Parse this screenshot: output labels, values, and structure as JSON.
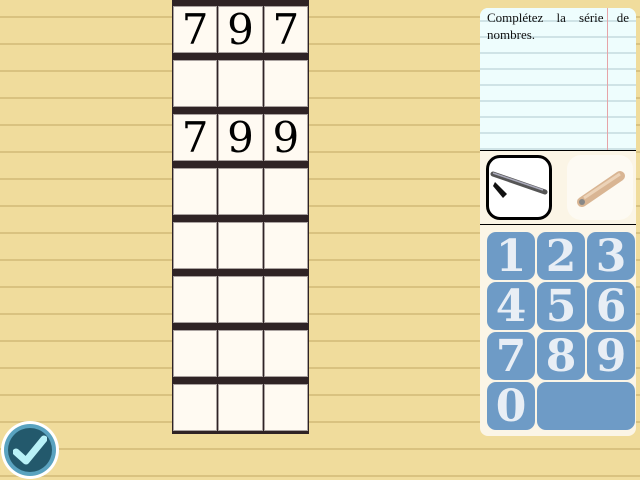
{
  "grid": {
    "rows": [
      [
        "7",
        "9",
        "7"
      ],
      [
        "",
        "",
        ""
      ],
      [
        "7",
        "9",
        "9"
      ],
      [
        "",
        "",
        ""
      ],
      [
        "",
        "",
        ""
      ],
      [
        "",
        "",
        ""
      ],
      [
        "",
        "",
        ""
      ],
      [
        "",
        "",
        ""
      ]
    ]
  },
  "instruction": "Complétez la série de nombres.",
  "tools": [
    {
      "name": "pen-icon",
      "selected": true
    },
    {
      "name": "pencil-icon",
      "selected": false
    }
  ],
  "keypad": [
    "1",
    "2",
    "3",
    "4",
    "5",
    "6",
    "7",
    "8",
    "9",
    "0",
    ""
  ],
  "check_icon": "checkmark-icon"
}
